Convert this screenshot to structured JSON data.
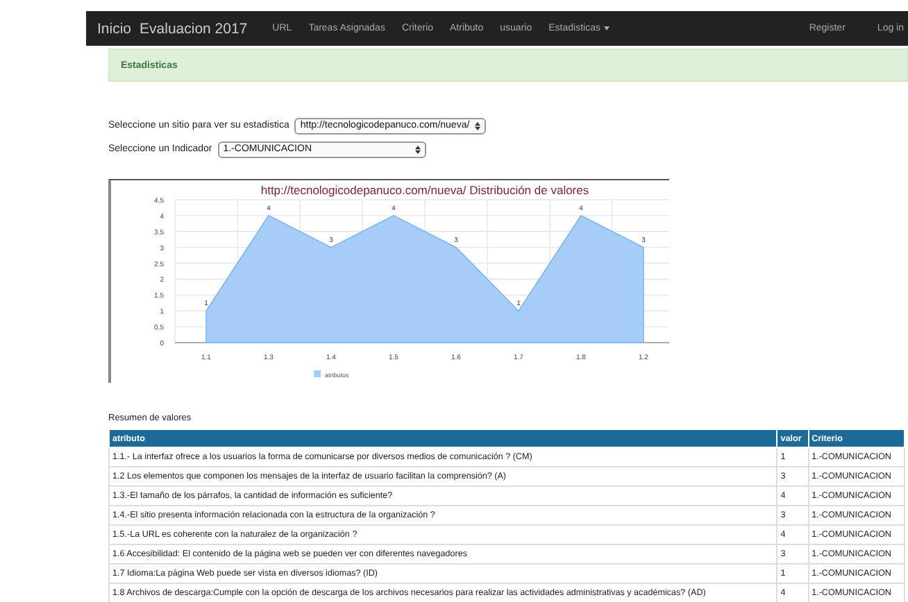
{
  "navbar": {
    "brand_items": [
      "Inicio",
      "Evaluacion 2017"
    ],
    "items": [
      {
        "label": "URL",
        "kind": "link"
      },
      {
        "label": "Tareas Asignadas",
        "kind": "link"
      },
      {
        "label": "Criterio",
        "kind": "link"
      },
      {
        "label": "Atributo",
        "kind": "link"
      },
      {
        "label": "usuario",
        "kind": "link"
      },
      {
        "label": "Estadisticas",
        "kind": "dropdown"
      }
    ],
    "right_items": [
      "Register",
      "Log in"
    ]
  },
  "alert": {
    "text": "Estadisticas"
  },
  "form": [
    {
      "label": "Seleccione un sitio para ver su estadistica",
      "value": "http://tecnologicodepanuco.com/nueva/",
      "kind": "short"
    },
    {
      "label": "Seleccione un Indicador",
      "value": "1.-COMUNICACION",
      "kind": "wide"
    }
  ],
  "chart": {
    "chart_data": {
      "type": "area",
      "title": "http://tecnologicodepanuco.com/nueva/ Distribución de valores",
      "categories": [
        "1.1",
        "1.3",
        "1.4",
        "1.5",
        "1.6",
        "1.7",
        "1.8",
        "1.2"
      ],
      "series": [
        {
          "name": "atributos",
          "color": "#a6cdf7",
          "values": [
            1,
            4,
            3,
            4,
            3,
            1,
            4,
            3
          ]
        }
      ],
      "ylim": [
        0,
        4.5
      ],
      "yticks": [
        0,
        0.5,
        1,
        1.5,
        2,
        2.5,
        3,
        3.5,
        4,
        4.5
      ],
      "data_labels": true,
      "grid": true
    }
  },
  "summary": {
    "title": "Resumen de valores",
    "columns": [
      "atributo",
      "valor",
      "Criterio"
    ],
    "rows": [
      [
        "1.1.- La interfaz ofrece a los usuarios la forma de comunicarse por diversos medios de comunicación ? (CM)",
        "1",
        "1.-COMUNICACION"
      ],
      [
        "1.2 Los elementos que componen los mensajes de la interfaz de usuario facilitan la comprensión? (A)",
        "3",
        "1.-COMUNICACION"
      ],
      [
        "1.3.-El tamaño de los párrafos, la cantidad de información es suficiente?",
        "4",
        "1.-COMUNICACION"
      ],
      [
        "1.4.-El sitio presenta información relacionada con la estructura de la organización ?",
        "3",
        "1.-COMUNICACION"
      ],
      [
        "1.5.-La URL es coherente con la naturalez de la organización ?",
        "4",
        "1.-COMUNICACION"
      ],
      [
        "1.6 Accesibilidad: El contenido de la página web se pueden ver con diferentes navegadores",
        "3",
        "1.-COMUNICACION"
      ],
      [
        "1.7 Idioma:La página Web puede ser vista en diversos idiomas? (ID)",
        "1",
        "1.-COMUNICACION"
      ],
      [
        "1.8 Archivos de descarga:Cumple con la opción de descarga de los archivos necesarios para realizar las actividades administrativas y académicas? (AD)",
        "4",
        "1.-COMUNICACION"
      ]
    ]
  }
}
